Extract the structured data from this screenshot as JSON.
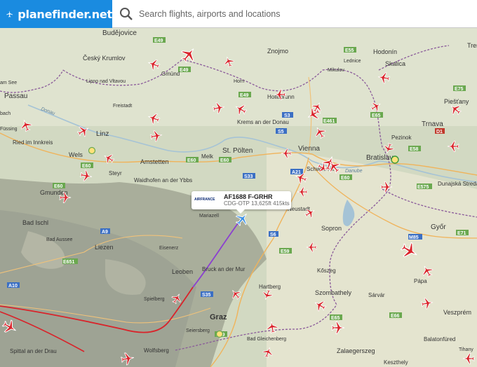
{
  "header": {
    "brand": "planefinder.net",
    "search_placeholder": "Search flights, airports and locations"
  },
  "tooltip": {
    "airline_logo": "AIRFRANCE",
    "callsign": "AF1688 F-GRHR",
    "route": "CDG-OTP 13,625ft 415kts"
  },
  "places": {
    "budejovice": "Budějovice",
    "cesky_krumlov": "Český Krumlov",
    "lipno": "Lipno nad Vltavou",
    "gmund": "Gmünd",
    "passau": "Passau",
    "freistadt": "Freistadt",
    "bach": "bach",
    "fussing": "Füssing",
    "ried": "Ried im Innkreis",
    "linz": "Linz",
    "wels": "Wels",
    "steyr": "Steyr",
    "amstetten": "Amstetten",
    "melk": "Melk",
    "stpolten": "St. Pölten",
    "waidhofen": "Waidhofen an der Ybbs",
    "krems": "Krems an der Donau",
    "horn": "Horn",
    "hollabrunn": "Hollabrunn",
    "znojmo": "Znojmo",
    "mikulov": "Mikulov",
    "lednice": "Lednice",
    "hodonin": "Hodonín",
    "skalica": "Skalica",
    "trnava": "Trnava",
    "piestany": "Piešťany",
    "pezinok": "Pezinok",
    "vienna": "Vienna",
    "bratislava": "Bratislava",
    "dunajska": "Dunajská Streda",
    "schwechat": "Schwechat",
    "neustadt": "Neustadt",
    "sopron": "Sopron",
    "gyor": "Győr",
    "gmunden": "Gmunden",
    "badischl": "Bad Ischl",
    "badaussee": "Bad Aussee",
    "liezen": "Liezen",
    "eisenerz": "Eisenerz",
    "mariazell": "Mariazell",
    "leoben": "Leoben",
    "bruck": "Bruck an der Mur",
    "spielberg": "Spielberg",
    "hartberg": "Hartberg",
    "koszeg": "Kőszeg",
    "szombathely": "Szombathely",
    "sarvar": "Sárvár",
    "papa": "Pápa",
    "veszprem": "Veszprém",
    "graz": "Graz",
    "seiersberg": "Seiersberg",
    "wolfsberg": "Wolfsberg",
    "badgleich": "Bad Gleichenberg",
    "zalaeg": "Zalaegerszeg",
    "keszthely": "Keszthely",
    "balaton": "Balatonfüred",
    "tihany": "Tihany",
    "spittal": "Spittal an der Drau",
    "trenc": "Tren",
    "danube": "Danube",
    "donau": "Donau",
    "am_see": "am See"
  },
  "roads": [
    "E49",
    "E49",
    "E49",
    "E55",
    "E50",
    "E60",
    "E60",
    "E60",
    "E60",
    "E461",
    "E65",
    "E65",
    "E75",
    "E58",
    "E575",
    "E59",
    "E59",
    "E60",
    "E65",
    "E66",
    "E71",
    "E651",
    "S3",
    "S5",
    "S33",
    "A21",
    "A9",
    "A10",
    "S6",
    "S35",
    "A1",
    "D1",
    "M85",
    "E66"
  ],
  "colors": {
    "brand_blue": "#1a8be0",
    "aircraft_red": "#d9232a",
    "selected_aircraft_blue": "#3a8fe6",
    "track_red": "#d9232a",
    "track_purple": "#8b3fd1",
    "border_purple": "#8a5a9a",
    "road_green": "#6aa84f"
  },
  "icons": [
    "planefinder-logo-icon",
    "search-icon",
    "aircraft-icon",
    "airport-icon"
  ]
}
